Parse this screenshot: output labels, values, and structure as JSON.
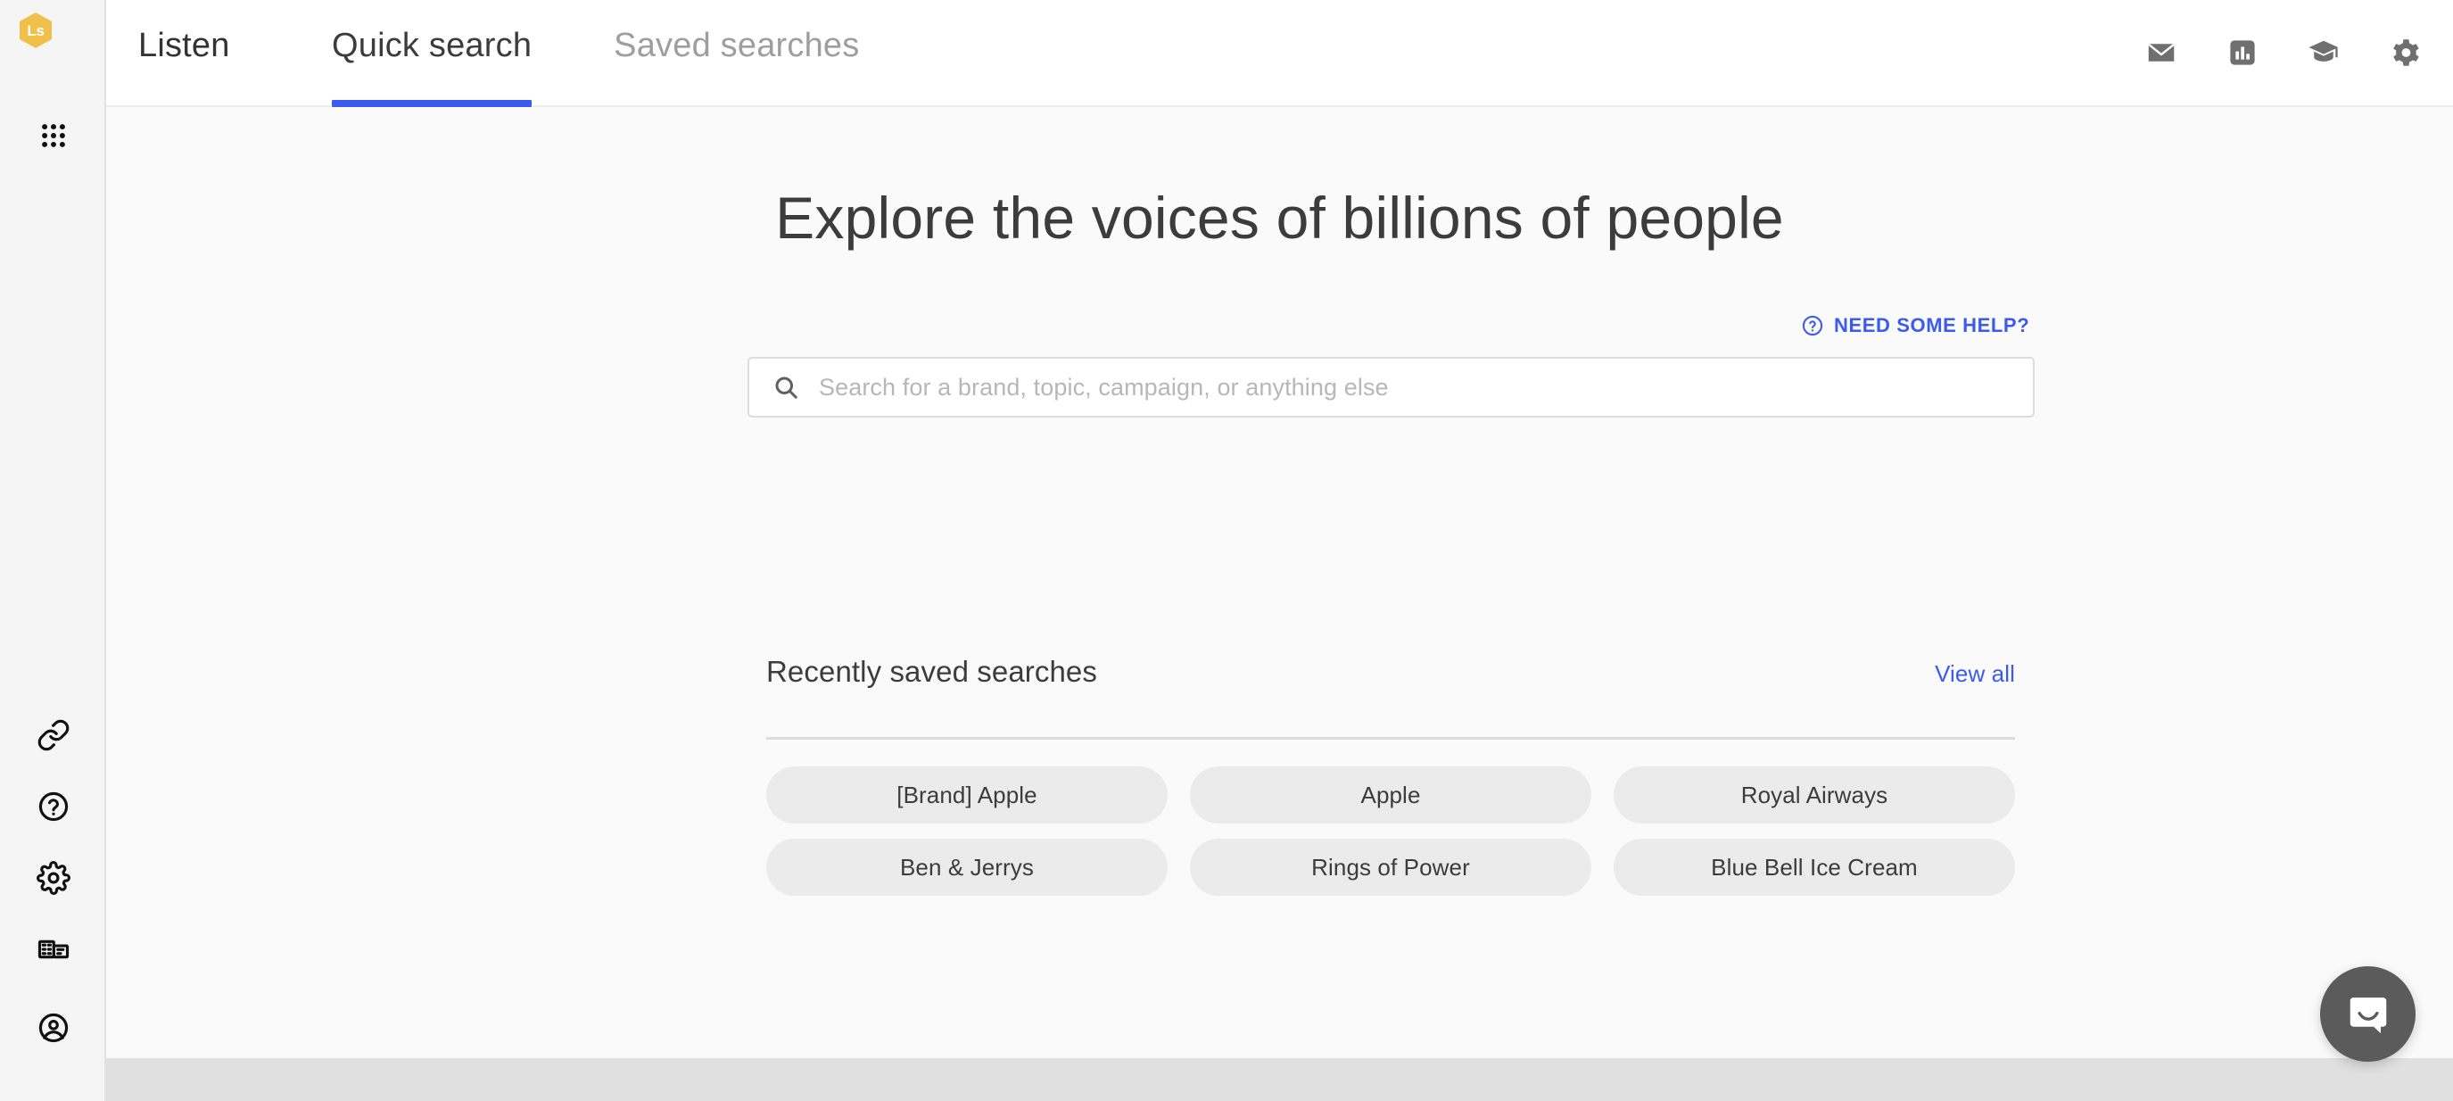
{
  "brand": {
    "logo_text": "Ls",
    "logo_color": "#f0c04b",
    "accent_color": "#3b5bf0"
  },
  "topbar": {
    "app_name": "Listen",
    "tabs": [
      {
        "label": "Quick search",
        "active": true
      },
      {
        "label": "Saved searches",
        "active": false
      }
    ],
    "actions": [
      {
        "name": "mail-icon",
        "label": "Mail"
      },
      {
        "name": "insights-icon",
        "label": "Insights"
      },
      {
        "name": "academy-icon",
        "label": "Academy"
      },
      {
        "name": "settings-icon",
        "label": "Settings"
      }
    ]
  },
  "sidebar": {
    "items": [
      {
        "name": "apps-grid-icon",
        "label": "Apps"
      },
      {
        "name": "link-icon",
        "label": "Integrations"
      },
      {
        "name": "help-circle-icon",
        "label": "Help"
      },
      {
        "name": "gear-icon",
        "label": "Settings"
      },
      {
        "name": "organization-icon",
        "label": "Organization"
      },
      {
        "name": "account-icon",
        "label": "Account"
      }
    ]
  },
  "main": {
    "title": "Explore the voices of billions of people",
    "help_link": "NEED SOME HELP?",
    "search": {
      "value": "",
      "placeholder": "Search for a brand, topic, campaign, or anything else"
    },
    "saved": {
      "title": "Recently saved searches",
      "view_all": "View all",
      "chips": [
        "[Brand] Apple",
        "Apple",
        "Royal Airways",
        "Ben & Jerrys",
        "Rings of Power",
        "Blue Bell Ice Cream"
      ]
    }
  },
  "chat": {
    "name": "chat-launcher",
    "label": "Open messenger"
  }
}
